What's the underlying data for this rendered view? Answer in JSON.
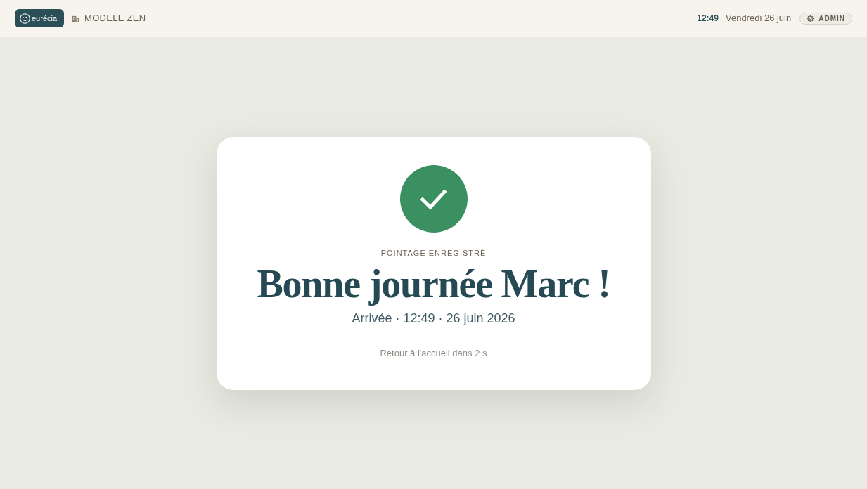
{
  "header": {
    "logo": {
      "text": "eurécia"
    },
    "site": {
      "label": "MODELE ZEN"
    },
    "time": "12:49",
    "date": "Vendredi 26 juin",
    "admin_button": {
      "label": "ADMIN"
    }
  },
  "confirmation": {
    "kind": "success",
    "eyebrow": "POINTAGE ENREGISTRÉ",
    "title": "Bonne journée Marc !",
    "details": "Arrivée · 12:49 · 26 juin 2026",
    "redirect_notice": "Retour à l'accueil dans 2 s"
  }
}
